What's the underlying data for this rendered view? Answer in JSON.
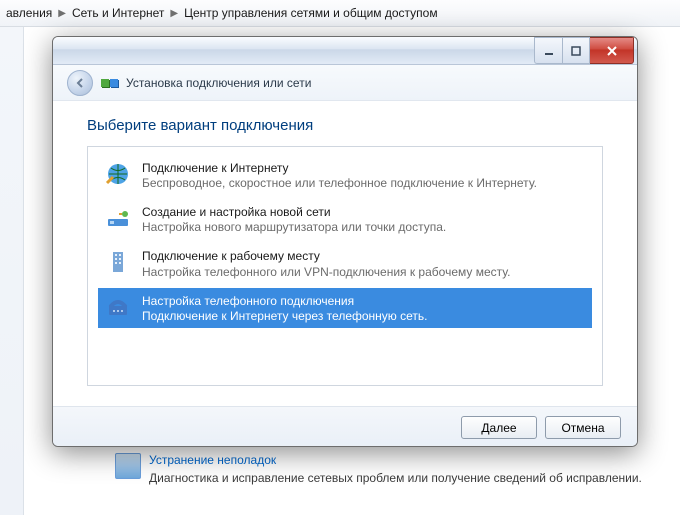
{
  "breadcrumb": {
    "part1": "авления",
    "part2": "Сеть и Интернет",
    "part3": "Центр управления сетями и общим доступом"
  },
  "background": {
    "troubleshoot_link": "Устранение неполадок",
    "troubleshoot_sub": "Диагностика и исправление сетевых проблем или получение сведений об исправлении."
  },
  "dialog": {
    "title": "Установка подключения или сети",
    "prompt": "Выберите вариант подключения",
    "options": [
      {
        "title": "Подключение к Интернету",
        "subtitle": "Беспроводное, скоростное или телефонное подключение к Интернету.",
        "icon": "globe-icon",
        "selected": false
      },
      {
        "title": "Создание и настройка новой сети",
        "subtitle": "Настройка нового маршрутизатора или точки доступа.",
        "icon": "router-icon",
        "selected": false
      },
      {
        "title": "Подключение к рабочему месту",
        "subtitle": "Настройка телефонного или VPN-подключения к рабочему месту.",
        "icon": "office-icon",
        "selected": false
      },
      {
        "title": "Настройка телефонного подключения",
        "subtitle": "Подключение к Интернету через телефонную сеть.",
        "icon": "phone-icon",
        "selected": true
      }
    ],
    "buttons": {
      "next": "Далее",
      "cancel": "Отмена"
    }
  }
}
